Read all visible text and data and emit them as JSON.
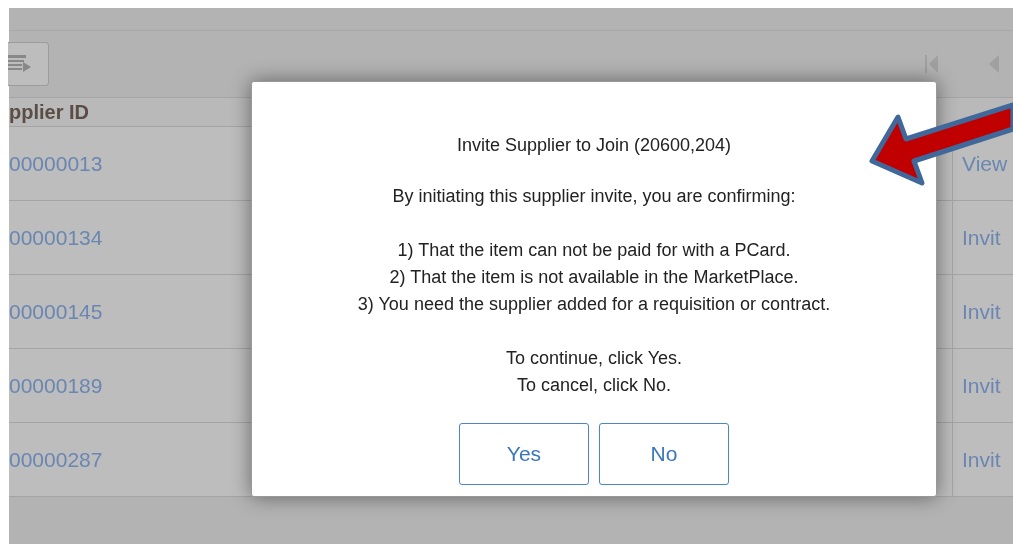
{
  "table": {
    "columns": [
      {
        "label": "pplier ID"
      }
    ],
    "rows": [
      {
        "supplier_id": "00000013",
        "action": "View"
      },
      {
        "supplier_id": "00000134",
        "action": "Invit"
      },
      {
        "supplier_id": "00000145",
        "action": "Invit"
      },
      {
        "supplier_id": "00000189",
        "action": "Invit"
      },
      {
        "supplier_id": "00000287",
        "action": "Invit"
      }
    ]
  },
  "dialog": {
    "title": "Invite Supplier to Join (20600,204)",
    "intro": "By initiating this supplier invite, you are confirming:",
    "conditions": [
      "1) That the item can not be paid for with a PCard.",
      "2) That the item is not available in the MarketPlace.",
      "3) You need the supplier added for a requisition or contract."
    ],
    "instructions": [
      "To continue, click Yes.",
      "To cancel, click No."
    ],
    "buttons": [
      {
        "label": "Yes"
      },
      {
        "label": "No"
      }
    ]
  }
}
